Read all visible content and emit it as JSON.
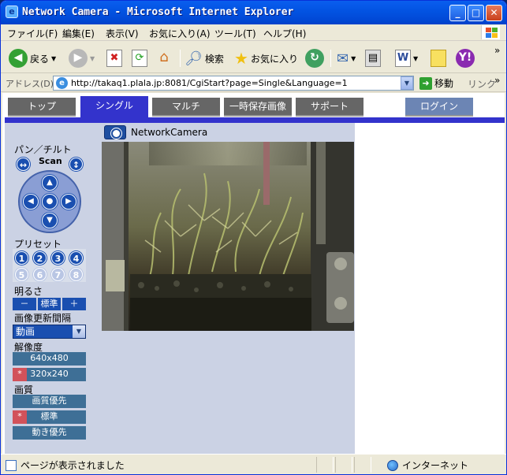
{
  "window": {
    "title": "Network Camera - Microsoft Internet Explorer",
    "min": "_",
    "max": "□",
    "close": "✕"
  },
  "menu": [
    "ファイル(F)",
    "編集(E)",
    "表示(V)",
    "お気に入り(A)",
    "ツール(T)",
    "ヘルプ(H)"
  ],
  "toolbar": {
    "back": "戻る",
    "search": "検索",
    "favorites": "お気に入り",
    "chevron": "»"
  },
  "address": {
    "label": "アドレス(D)",
    "url": "http://takaq1.plala.jp:8081/CgiStart?page=Single&Language=1",
    "go": "移動",
    "links": "リンク",
    "chevron": "»"
  },
  "tabs": [
    {
      "label": "トップ"
    },
    {
      "label": "シングル",
      "active": true
    },
    {
      "label": "マルチ"
    },
    {
      "label": "一時保存画像"
    },
    {
      "label": "サポート"
    },
    {
      "label": "ログイン"
    }
  ],
  "camera": {
    "name": "NetworkCamera"
  },
  "sidebar": {
    "pantilt_label": "パン／チルト",
    "scan_label": "Scan",
    "preset_label": "プリセット",
    "presets": [
      "1",
      "2",
      "3",
      "4",
      "5",
      "6",
      "7",
      "8"
    ],
    "brightness_label": "明るさ",
    "brightness": {
      "minus": "－",
      "standard": "標準",
      "plus": "＋"
    },
    "refresh_label": "画像更新間隔",
    "refresh_value": "動画",
    "resolution_label": "解像度",
    "resolutions": [
      {
        "label": "640x480",
        "selected": false
      },
      {
        "label": "320x240",
        "selected": true
      }
    ],
    "quality_label": "画質",
    "qualities": [
      {
        "label": "画質優先",
        "selected": false
      },
      {
        "label": "標準",
        "selected": true
      },
      {
        "label": "動き優先",
        "selected": false
      }
    ],
    "selected_mark": "*"
  },
  "status": {
    "left": "ページが表示されました",
    "zone": "インターネット"
  }
}
